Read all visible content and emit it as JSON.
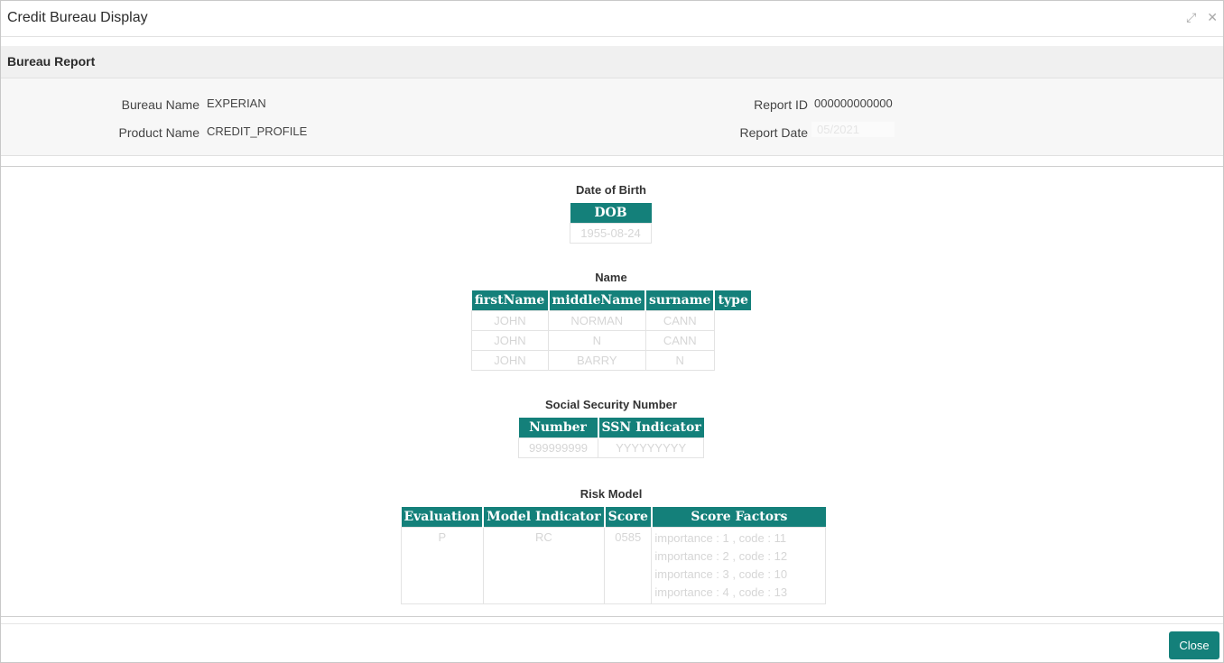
{
  "window": {
    "title": "Credit Bureau Display",
    "icons": [
      "minimize-icon",
      "close-icon"
    ]
  },
  "section": {
    "title": "Bureau Report"
  },
  "info": {
    "bureau_name_label": "Bureau Name",
    "bureau_name_value": "EXPERIAN",
    "product_name_label": "Product Name",
    "product_name_value": "CREDIT_PROFILE",
    "report_id_label": "Report ID",
    "report_id_value": "000000000000",
    "report_date_label": "Report Date",
    "report_date_value": "05/2021"
  },
  "dob": {
    "title": "Date of Birth",
    "header": "DOB",
    "value": "1955-08-24"
  },
  "name": {
    "title": "Name",
    "headers": [
      "firstName",
      "middleName",
      "surname",
      "type"
    ],
    "rows": [
      [
        "JOHN",
        "NORMAN",
        "CANN",
        ""
      ],
      [
        "JOHN",
        "N",
        "CANN",
        ""
      ],
      [
        "JOHN",
        "BARRY",
        "N",
        ""
      ]
    ]
  },
  "ssn": {
    "title": "Social Security Number",
    "headers": [
      "Number",
      "SSN Indicator"
    ],
    "rows": [
      [
        "999999999",
        "YYYYYYYYY"
      ]
    ]
  },
  "risk": {
    "title": "Risk Model",
    "headers": [
      "Evaluation",
      "Model Indicator",
      "Score",
      "Score Factors"
    ],
    "evaluation": "P",
    "model_indicator": "RC",
    "score": "0585",
    "factors": [
      "importance : 1 , code : 11",
      "importance : 2 , code : 12",
      "importance : 3 , code : 10",
      "importance : 4 , code : 13"
    ]
  },
  "footer": {
    "close_label": "Close"
  },
  "colors": {
    "accent": "#14807a",
    "section_bg": "#f0f0f0",
    "info_bg": "#f7f7f7"
  }
}
